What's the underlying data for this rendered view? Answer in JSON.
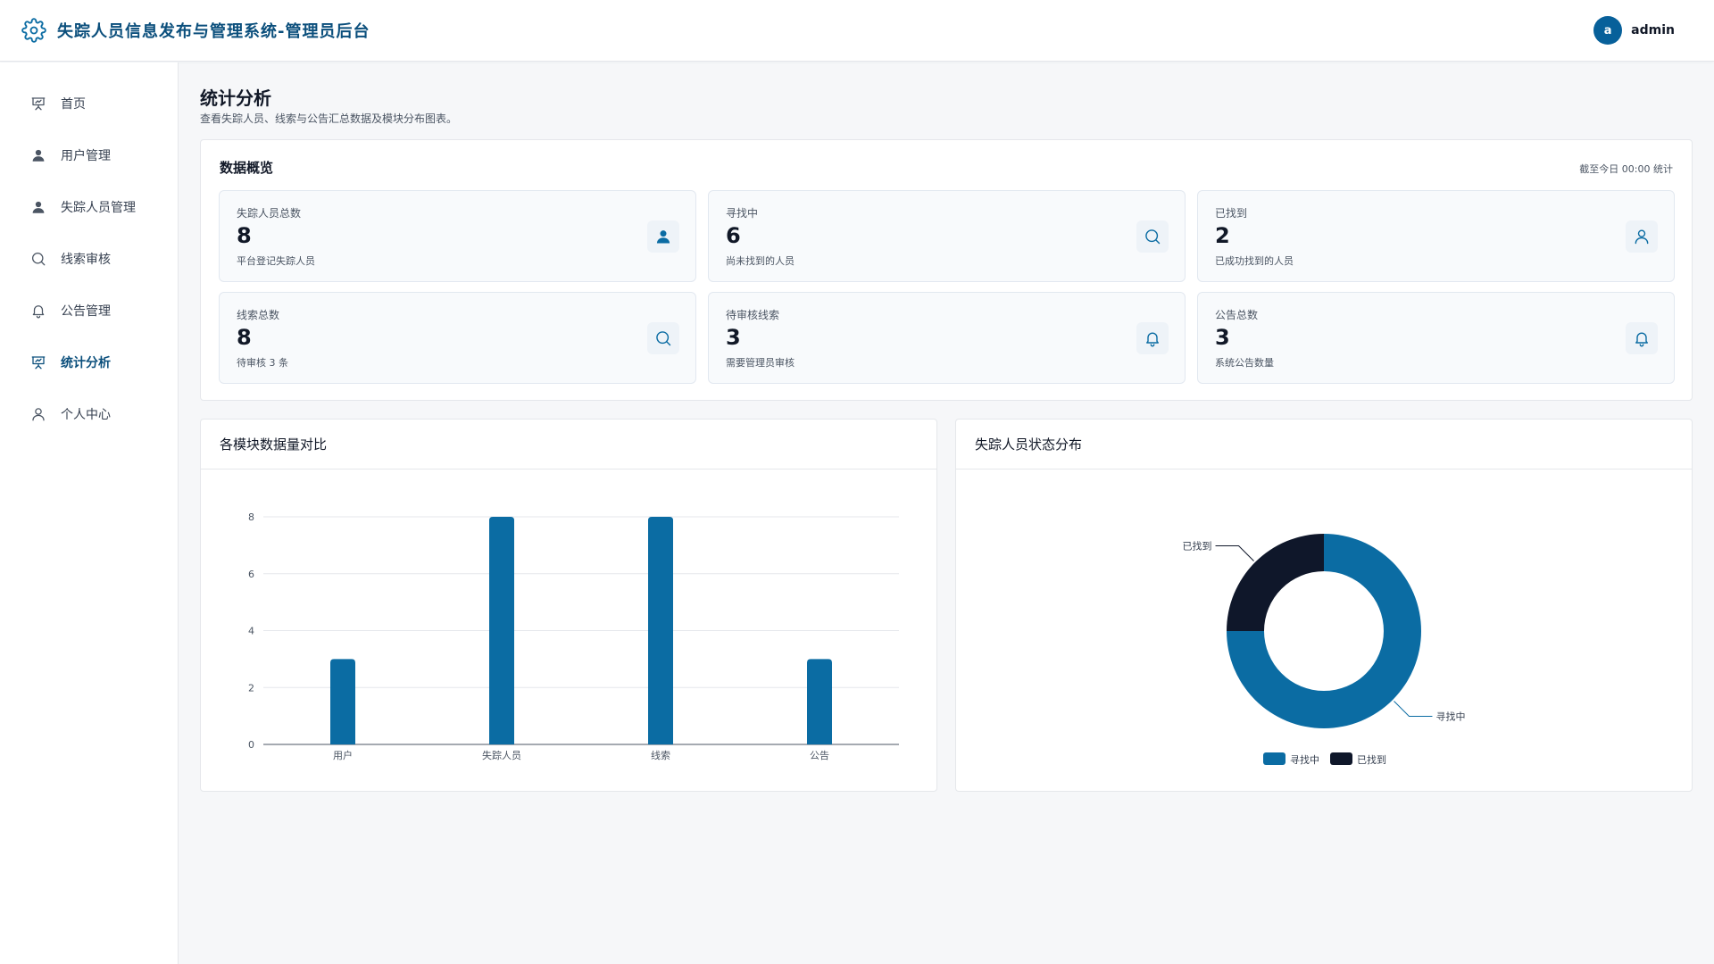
{
  "header": {
    "title": "失踪人员信息发布与管理系统-管理员后台",
    "user": {
      "avatar_letter": "a",
      "name": "admin"
    }
  },
  "sidebar": {
    "items": [
      {
        "label": "首页",
        "icon": "presentation-icon",
        "active": false
      },
      {
        "label": "用户管理",
        "icon": "user-filled-icon",
        "active": false
      },
      {
        "label": "失踪人员管理",
        "icon": "user-filled-icon",
        "active": false
      },
      {
        "label": "线索审核",
        "icon": "search-icon",
        "active": false
      },
      {
        "label": "公告管理",
        "icon": "bell-icon",
        "active": false
      },
      {
        "label": "统计分析",
        "icon": "presentation-icon",
        "active": true
      },
      {
        "label": "个人中心",
        "icon": "user-outline-icon",
        "active": false
      }
    ]
  },
  "page": {
    "title": "统计分析",
    "subtitle": "查看失踪人员、线索与公告汇总数据及模块分布图表。"
  },
  "overview": {
    "title": "数据概览",
    "note": "截至今日 00:00 统计",
    "cards": [
      {
        "label": "失踪人员总数",
        "value": "8",
        "desc": "平台登记失踪人员",
        "icon": "user-filled-icon"
      },
      {
        "label": "寻找中",
        "value": "6",
        "desc": "尚未找到的人员",
        "icon": "search-icon"
      },
      {
        "label": "已找到",
        "value": "2",
        "desc": "已成功找到的人员",
        "icon": "user-outline-icon"
      },
      {
        "label": "线索总数",
        "value": "8",
        "desc": "待审核 3 条",
        "icon": "search-icon"
      },
      {
        "label": "待审核线索",
        "value": "3",
        "desc": "需要管理员审核",
        "icon": "bell-icon"
      },
      {
        "label": "公告总数",
        "value": "3",
        "desc": "系统公告数量",
        "icon": "bell-icon"
      }
    ]
  },
  "panels": {
    "bar_title": "各模块数据量对比",
    "pie_title": "失踪人员状态分布"
  },
  "colors": {
    "primary": "#0b6ca3",
    "dark": "#0f172a",
    "brand": "#0b4f7c"
  },
  "chart_data": [
    {
      "type": "bar",
      "title": "各模块数据量对比",
      "categories": [
        "用户",
        "失踪人员",
        "线索",
        "公告"
      ],
      "values": [
        3,
        8,
        8,
        3
      ],
      "ylim": [
        0,
        8
      ],
      "yticks": [
        0,
        2,
        4,
        6,
        8
      ],
      "grid": true,
      "color": "#0b6ca3"
    },
    {
      "type": "pie",
      "donut": true,
      "title": "失踪人员状态分布",
      "labels": [
        "寻找中",
        "已找到"
      ],
      "values": [
        6,
        2
      ],
      "colors": [
        "#0b6ca3",
        "#0f172a"
      ],
      "legend": "bottom"
    }
  ]
}
